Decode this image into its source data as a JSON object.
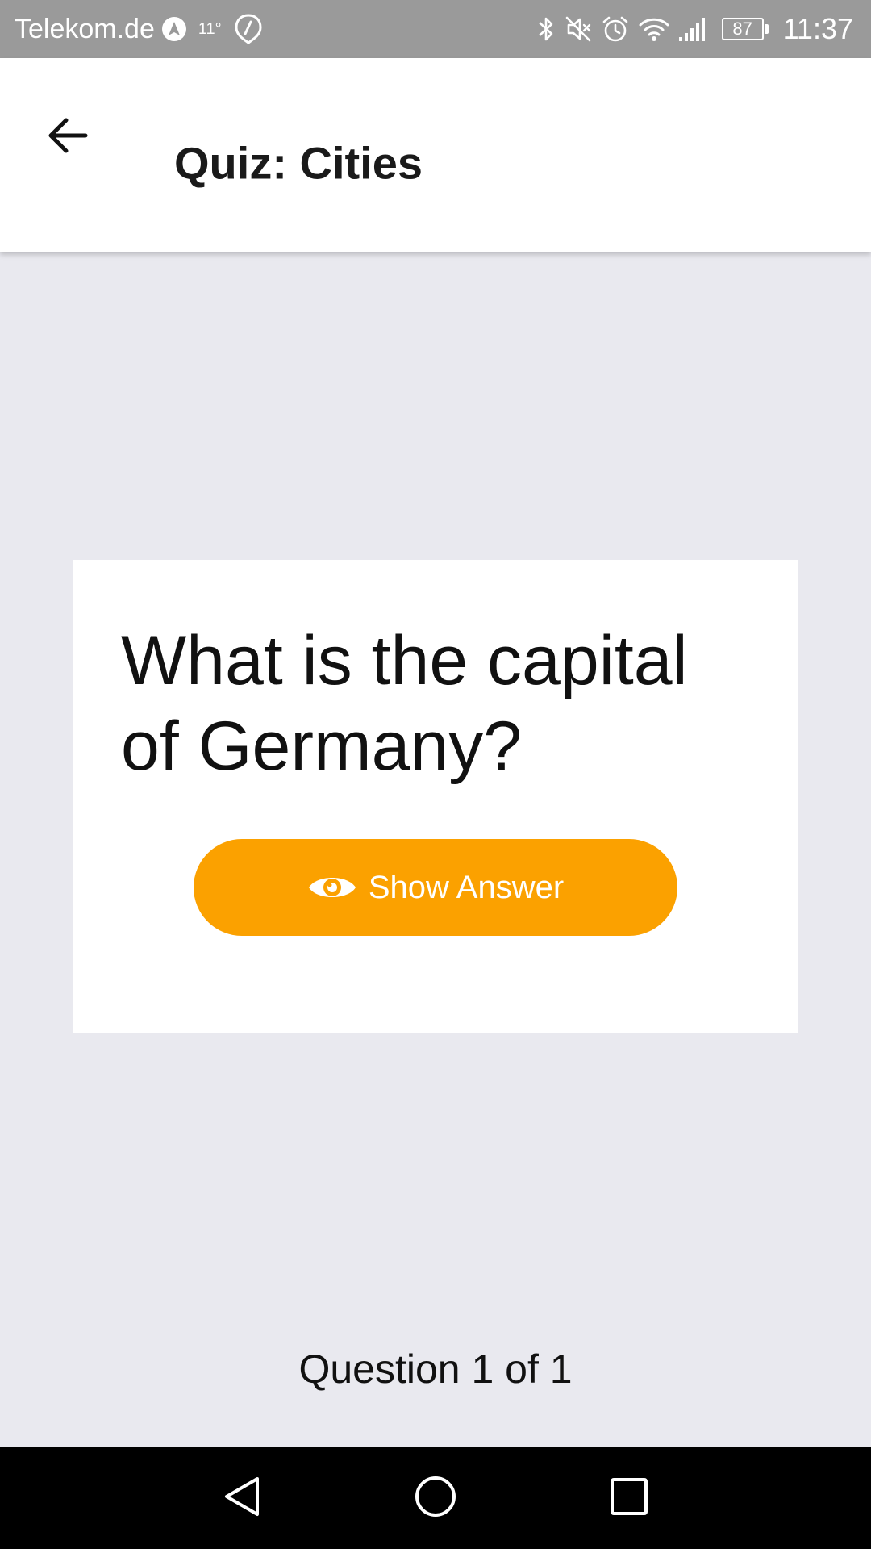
{
  "status_bar": {
    "carrier": "Telekom.de",
    "temperature": "11°",
    "battery_level": "87",
    "time": "11:37",
    "icons": [
      "navigation-arrow-icon",
      "compass-icon",
      "bluetooth-icon",
      "mute-icon",
      "alarm-icon",
      "wifi-icon",
      "signal-icon",
      "battery-icon"
    ]
  },
  "app_bar": {
    "title": "Quiz: Cities",
    "back_icon": "arrow-left-icon"
  },
  "quiz": {
    "question": "What is the capital of Germany?",
    "show_answer_label": "Show Answer",
    "button_color": "#fba100"
  },
  "progress": {
    "text": "Question 1 of 1"
  },
  "nav_bar": {
    "icons": [
      "back-triangle-icon",
      "home-circle-icon",
      "recents-square-icon"
    ]
  }
}
